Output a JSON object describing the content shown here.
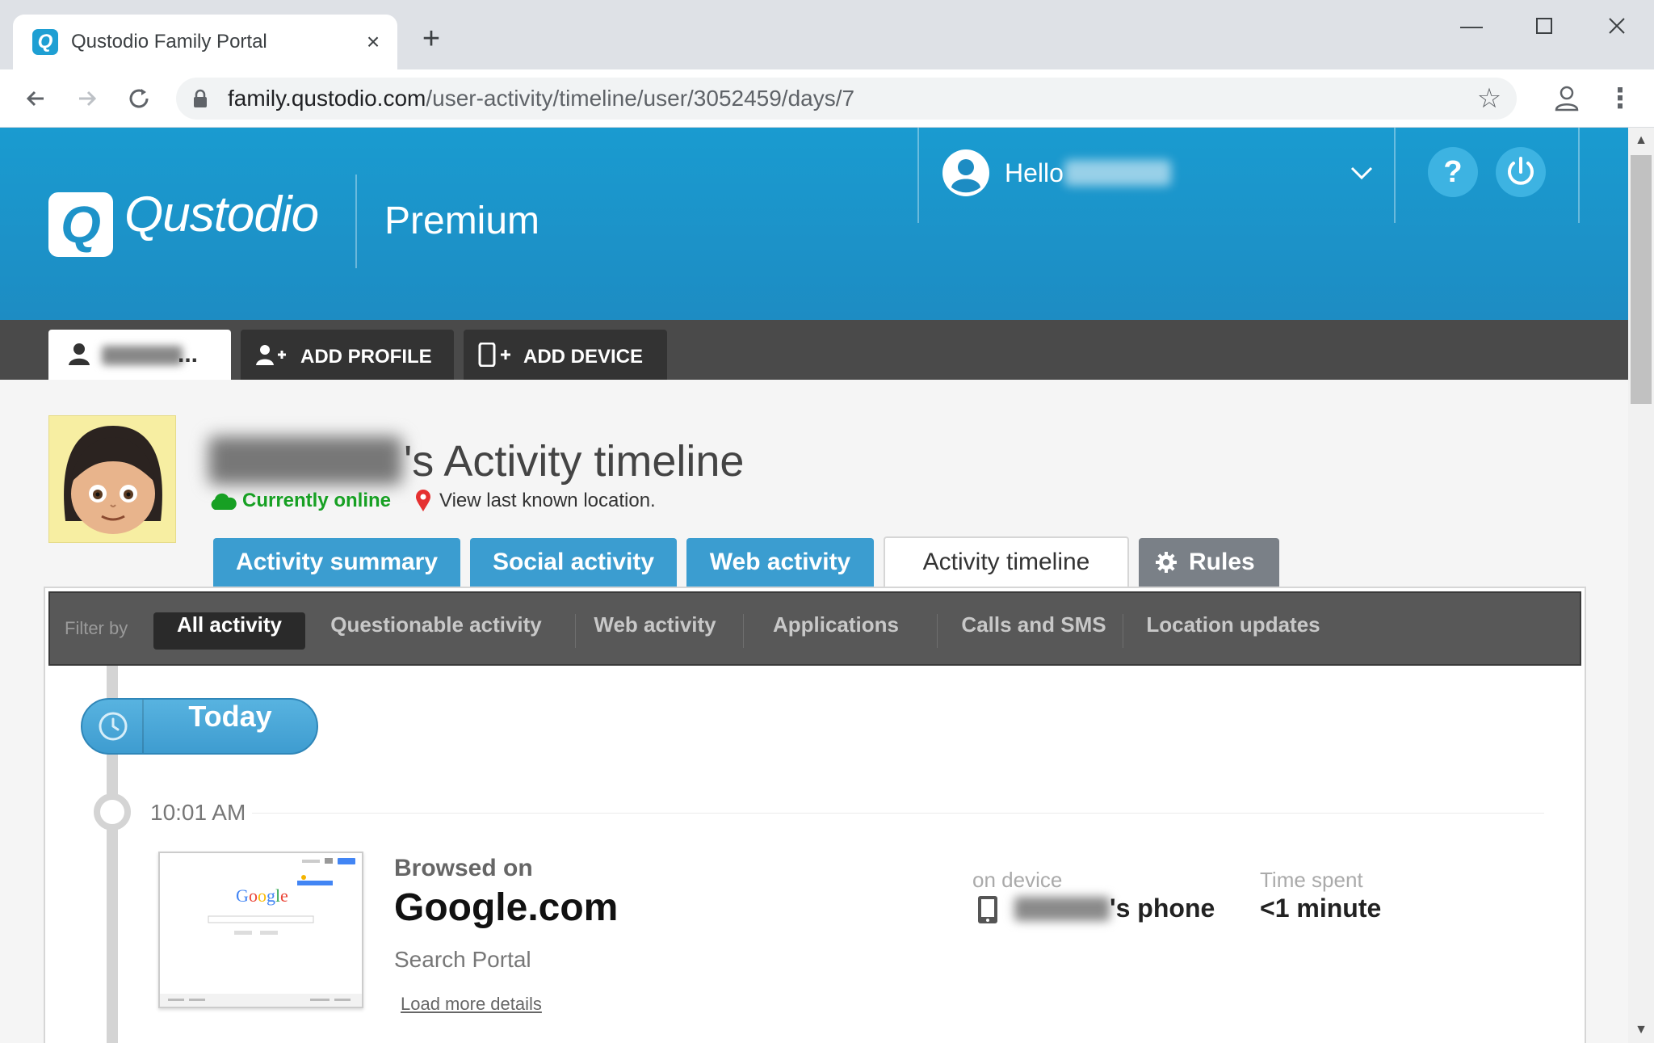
{
  "browser": {
    "tab_title": "Qustodio Family Portal",
    "tab_favicon_letter": "Q",
    "new_tab_glyph": "+",
    "url_host": "family.qustodio.com",
    "url_path": "/user-activity/timeline/user/3052459/days/7"
  },
  "header": {
    "logo_letter": "Q",
    "brand": "Qustodio",
    "plan": "Premium",
    "greeting": "Hello",
    "help_label": "?"
  },
  "profile_bar": {
    "ellipsis": "...",
    "add_profile": "ADD PROFILE",
    "add_device": "ADD DEVICE"
  },
  "child": {
    "heading_suffix": "'s Activity timeline",
    "status": "Currently online",
    "location_link": "View last known location."
  },
  "tabs": [
    {
      "label": "Activity summary"
    },
    {
      "label": "Social activity"
    },
    {
      "label": "Web activity"
    },
    {
      "label": "Activity timeline",
      "active": true
    },
    {
      "label": "Rules"
    }
  ],
  "filter": {
    "label": "Filter by",
    "items": [
      {
        "label": "All activity",
        "active": true
      },
      {
        "label": "Questionable activity"
      },
      {
        "label": "Web activity"
      },
      {
        "label": "Applications"
      },
      {
        "label": "Calls and SMS"
      },
      {
        "label": "Location updates"
      }
    ]
  },
  "timeline": {
    "day_label": "Today",
    "entries": [
      {
        "time": "10:01 AM",
        "type": "Browsed on",
        "site": "Google.com",
        "category": "Search Portal",
        "load_more": "Load more details",
        "device_label": "on device",
        "device_name": "'s phone",
        "time_spent_label": "Time spent",
        "time_spent": "<1 minute"
      }
    ]
  },
  "colors": {
    "header_blue": "#1a9bd0",
    "tab_blue": "#3b9dd0",
    "online_green": "#17a023",
    "profile_bar": "#4a4a4a"
  },
  "icons": [
    "lock-icon",
    "star-icon",
    "account-icon",
    "user-avatar-icon",
    "chevron-down-icon",
    "help-icon",
    "power-icon",
    "user-icon",
    "add-user-icon",
    "add-device-icon",
    "cloud-icon",
    "map-pin-icon",
    "gear-icon",
    "clock-icon",
    "phone-icon"
  ]
}
